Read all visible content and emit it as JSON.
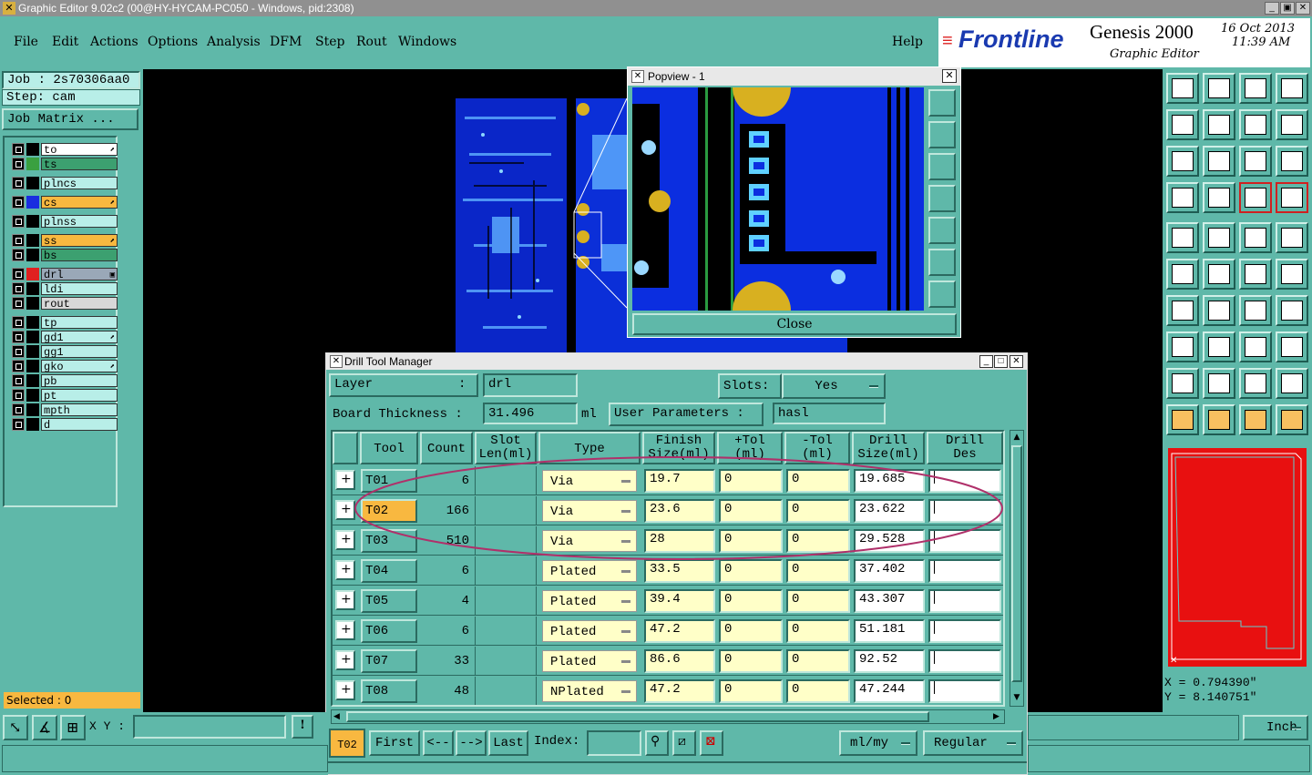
{
  "window": {
    "title": "Graphic Editor 9.02c2 (00@HY-HYCAM-PC050 - Windows, pid:2308)"
  },
  "menu": [
    "File",
    "Edit",
    "Actions",
    "Options",
    "Analysis",
    "DFM",
    "Step",
    "Rout",
    "Windows"
  ],
  "help_label": "Help",
  "logo": {
    "brand": "Frontline",
    "product": "Genesis 2000",
    "subtitle": "Graphic Editor",
    "date": "16 Oct 2013",
    "time": "11:39 AM"
  },
  "job": {
    "job_label": "Job : 2s70306aa0",
    "step_label": "Step: cam",
    "matrix_button": "Job Matrix ..."
  },
  "layers": [
    {
      "name": "to",
      "color": "#000000",
      "bg": "#ffffff",
      "flag": "⬈"
    },
    {
      "name": "ts",
      "color": "#3aa040",
      "bg": "#3ca070",
      "flag": ""
    },
    {
      "name": "plncs",
      "color": "#000000",
      "bg": "#b8eee8",
      "flag": ""
    },
    {
      "name": "cs",
      "color": "#1a2ee0",
      "bg": "#f8b840",
      "flag": "⬈"
    },
    {
      "name": "plnss",
      "color": "#000000",
      "bg": "#b8eee8",
      "flag": ""
    },
    {
      "name": "ss",
      "color": "#000000",
      "bg": "#f8b840",
      "flag": "⬈"
    },
    {
      "name": "bs",
      "color": "#000000",
      "bg": "#3ca070",
      "flag": ""
    },
    {
      "name": "drl",
      "color": "#e02020",
      "bg": "#9aa8b8",
      "flag": "▣"
    },
    {
      "name": "ldi",
      "color": "#000000",
      "bg": "#b8eee8",
      "flag": ""
    },
    {
      "name": "rout",
      "color": "#000000",
      "bg": "#d8d8d8",
      "flag": ""
    },
    {
      "name": "tp",
      "color": "#000000",
      "bg": "#b8eee8",
      "flag": ""
    },
    {
      "name": "gd1",
      "color": "#000000",
      "bg": "#b8eee8",
      "flag": "⬈"
    },
    {
      "name": "gg1",
      "color": "#000000",
      "bg": "#b8eee8",
      "flag": ""
    },
    {
      "name": "gko",
      "color": "#000000",
      "bg": "#b8eee8",
      "flag": "⬈"
    },
    {
      "name": "pb",
      "color": "#000000",
      "bg": "#b8eee8",
      "flag": ""
    },
    {
      "name": "pt",
      "color": "#000000",
      "bg": "#b8eee8",
      "flag": ""
    },
    {
      "name": "mpth",
      "color": "#000000",
      "bg": "#b8eee8",
      "flag": ""
    },
    {
      "name": "d",
      "color": "#000000",
      "bg": "#b8eee8",
      "flag": ""
    }
  ],
  "selected_label": "Selected : 0",
  "xy_label": "X Y :",
  "units_select": "Inch",
  "coords": {
    "x": "X = 0.794390\"",
    "y": "Y = 8.140751\""
  },
  "popview": {
    "title": "Popview - 1",
    "close_button": "Close"
  },
  "drill": {
    "title": "Drill Tool Manager",
    "layer_label": "Layer",
    "layer_colon": ":",
    "layer_value": "drl",
    "slots_label": "Slots:",
    "slots_value": "Yes",
    "thickness_label": "Board Thickness :",
    "thickness_value": "31.496",
    "thickness_unit": "ml",
    "user_params_button": "User Parameters :",
    "user_params_value": "hasl",
    "columns": [
      "Tool",
      "Count",
      "Slot\nLen(ml)",
      "Type",
      "Finish\nSize(ml)",
      "+Tol\n(ml)",
      "-Tol\n(ml)",
      "Drill\nSize(ml)",
      "Drill\nDes"
    ],
    "rows": [
      {
        "tool": "T01",
        "count": "6",
        "type": "Via",
        "finish": "19.7",
        "ptol": "0",
        "ntol": "0",
        "drill": "19.685"
      },
      {
        "tool": "T02",
        "count": "166",
        "type": "Via",
        "finish": "23.6",
        "ptol": "0",
        "ntol": "0",
        "drill": "23.622"
      },
      {
        "tool": "T03",
        "count": "510",
        "type": "Via",
        "finish": "28",
        "ptol": "0",
        "ntol": "0",
        "drill": "29.528"
      },
      {
        "tool": "T04",
        "count": "6",
        "type": "Plated",
        "finish": "33.5",
        "ptol": "0",
        "ntol": "0",
        "drill": "37.402"
      },
      {
        "tool": "T05",
        "count": "4",
        "type": "Plated",
        "finish": "39.4",
        "ptol": "0",
        "ntol": "0",
        "drill": "43.307"
      },
      {
        "tool": "T06",
        "count": "6",
        "type": "Plated",
        "finish": "47.2",
        "ptol": "0",
        "ntol": "0",
        "drill": "51.181"
      },
      {
        "tool": "T07",
        "count": "33",
        "type": "Plated",
        "finish": "86.6",
        "ptol": "0",
        "ntol": "0",
        "drill": "92.52"
      },
      {
        "tool": "T08",
        "count": "48",
        "type": "NPlated",
        "finish": "47.2",
        "ptol": "0",
        "ntol": "0",
        "drill": "47.244"
      }
    ],
    "current_tool": "T02",
    "first_button": "First",
    "prev_button": "<--",
    "next_button": "-->",
    "last_button": "Last",
    "index_label": "Index:",
    "units_value": "ml/my",
    "mode_value": "Regular"
  },
  "colors": {
    "panel": "#5fb8a9",
    "board": "#0b2fd8",
    "highlight": "#f8b840",
    "annotation": "#b0306a"
  }
}
